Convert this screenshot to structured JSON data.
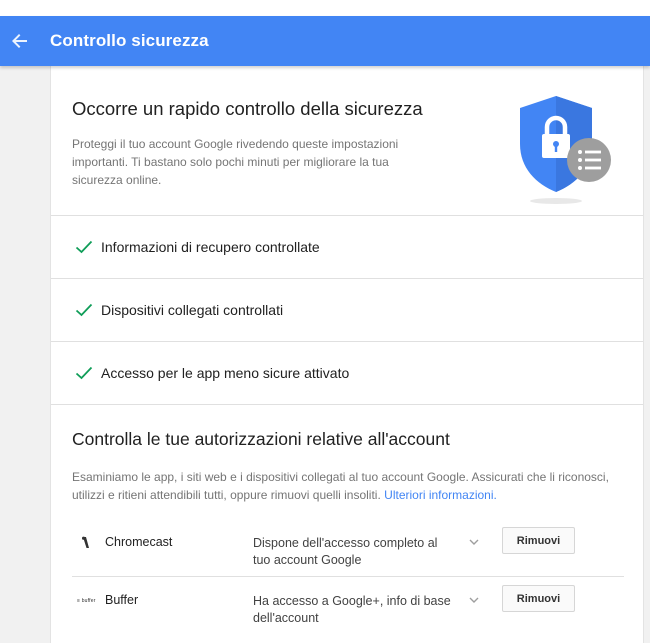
{
  "header": {
    "title": "Controllo sicurezza",
    "back_icon": "arrow-back-icon",
    "color": "#4285f4"
  },
  "intro": {
    "title": "Occorre un rapido controllo della sicurezza",
    "text": "Proteggi il tuo account Google rivedendo queste impostazioni importanti. Ti bastano solo pochi minuti per migliorare la tua sicurezza online.",
    "illustration": "shield-lock-icon"
  },
  "checks": [
    {
      "label": "Informazioni di recupero controllate",
      "icon": "check-icon"
    },
    {
      "label": "Dispositivi collegati controllati",
      "icon": "check-icon"
    },
    {
      "label": "Accesso per le app meno sicure attivato",
      "icon": "check-icon"
    }
  ],
  "permissions": {
    "title": "Controlla le tue autorizzazioni relative all'account",
    "text": "Esaminiamo le app, i siti web e i dispositivi collegati al tuo account Google. Assicurati che li riconosci, utilizzi e ritieni attendibili tutti, oppure rimuovi quelli insoliti.",
    "link": "Ulteriori informazioni.",
    "apps": [
      {
        "name": "Chromecast",
        "access": "Dispone dell'accesso completo al tuo account Google",
        "action": "Rimuovi",
        "icon": "chromecast-icon"
      },
      {
        "name": "Buffer",
        "access": "Ha accesso a Google+, info di base dell'account",
        "action": "Rimuovi",
        "icon": "buffer-logo",
        "icon_text": "≡ buffer"
      }
    ]
  }
}
